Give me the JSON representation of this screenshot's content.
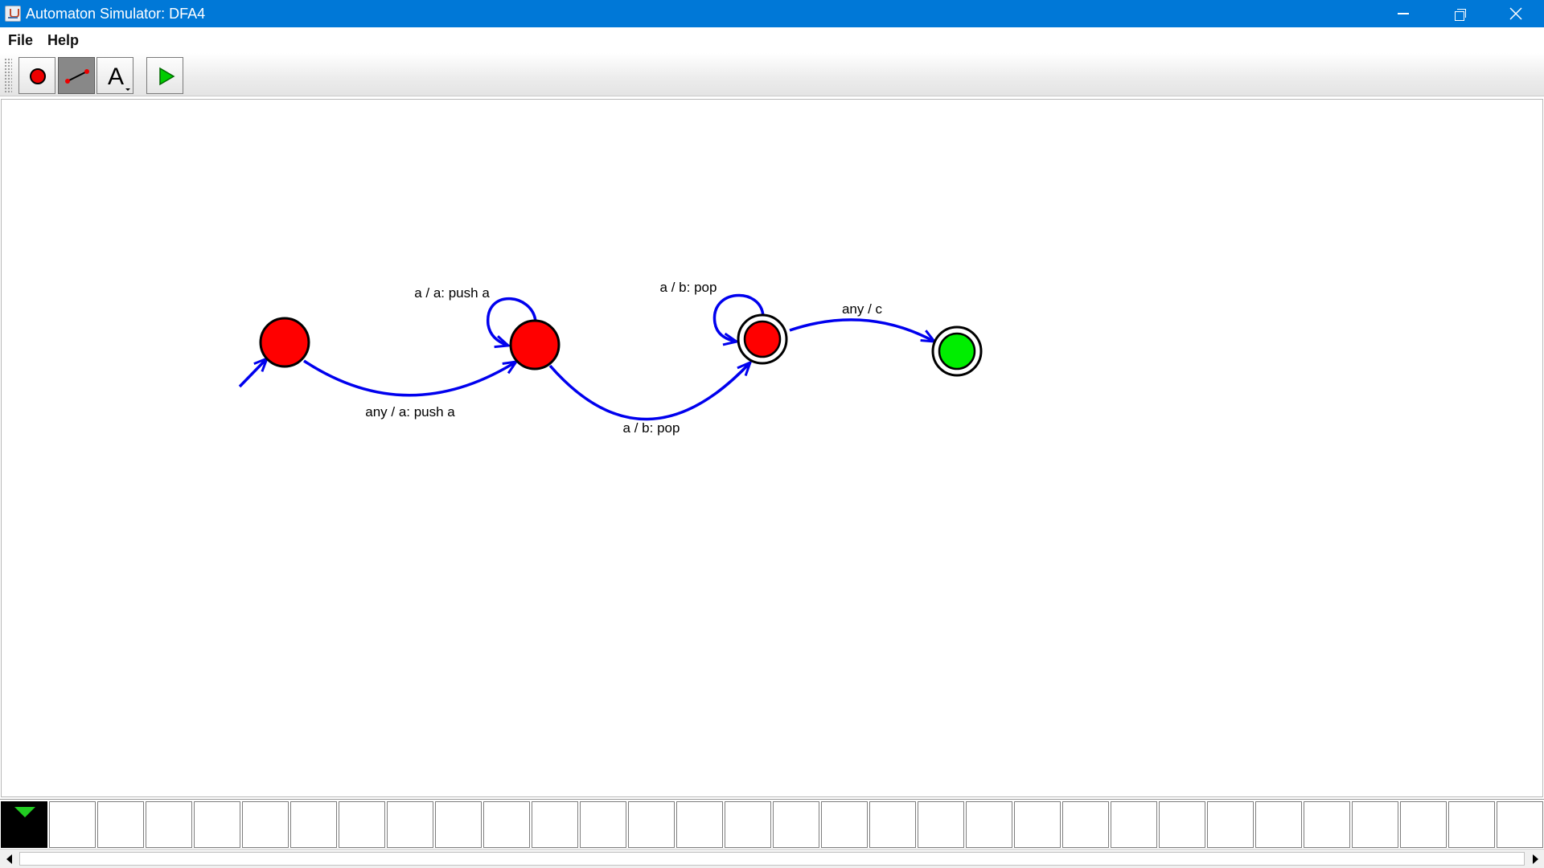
{
  "window": {
    "title": "Automaton Simulator: DFA4",
    "controls": [
      "minimize",
      "restore",
      "close"
    ]
  },
  "menu": {
    "items": [
      "File",
      "Help"
    ]
  },
  "toolbar": {
    "tools": [
      {
        "id": "state",
        "icon": "state-circle-icon",
        "selected": false
      },
      {
        "id": "transition",
        "icon": "transition-line-icon",
        "selected": true
      },
      {
        "id": "text",
        "icon": "text-A-icon",
        "label": "A",
        "selected": false
      },
      {
        "id": "run",
        "icon": "play-icon",
        "selected": false
      }
    ]
  },
  "colors": {
    "state_fill": "#ff0000",
    "current_state_fill": "#00ee00",
    "transition": "#0000ee",
    "title_bar": "#0078d7",
    "tape_head": "#22cc22"
  },
  "automaton": {
    "states": [
      {
        "id": "q0",
        "initial": true,
        "accepting": false,
        "current": false
      },
      {
        "id": "q1",
        "initial": false,
        "accepting": false,
        "current": false
      },
      {
        "id": "q2",
        "initial": false,
        "accepting": true,
        "current": false
      },
      {
        "id": "q3",
        "initial": false,
        "accepting": true,
        "current": true
      }
    ],
    "transitions": [
      {
        "from": "q0",
        "to": "q1",
        "label": "any / a: push a"
      },
      {
        "from": "q1",
        "to": "q1",
        "label": "a / a: push a"
      },
      {
        "from": "q1",
        "to": "q2",
        "label": "a / b: pop"
      },
      {
        "from": "q2",
        "to": "q2",
        "label": "a / b: pop"
      },
      {
        "from": "q2",
        "to": "q3",
        "label": "any / c"
      }
    ]
  },
  "tape": {
    "head_index": 0,
    "cell_count": 32,
    "cells": []
  }
}
